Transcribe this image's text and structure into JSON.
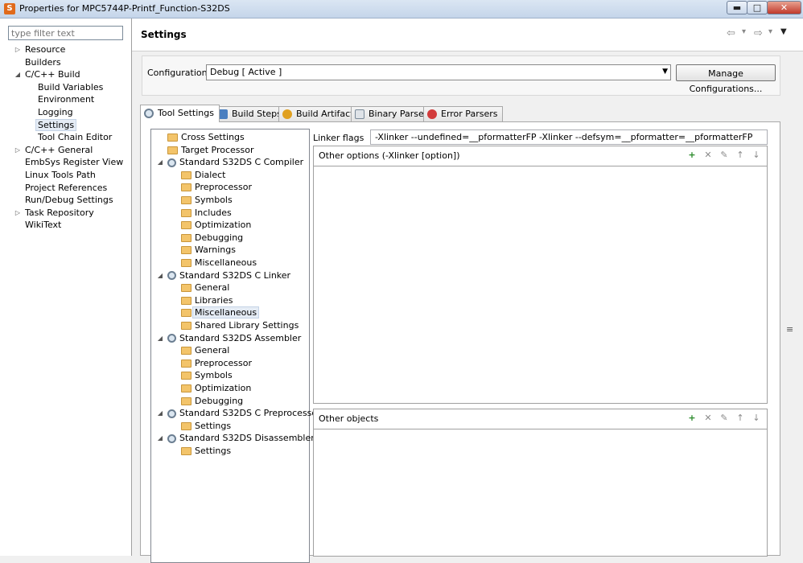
{
  "window": {
    "title": "Properties for MPC5744P-Printf_Function-S32DS",
    "app_icon_glyph": "S",
    "minimize_glyph": "▬",
    "maximize_glyph": "□",
    "close_glyph": "✕"
  },
  "filter": {
    "placeholder": "type filter text"
  },
  "nav": [
    {
      "label": "Resource",
      "twisty": "▷"
    },
    {
      "label": "Builders",
      "twisty": ""
    },
    {
      "label": "C/C++ Build",
      "twisty": "◢"
    },
    {
      "label": "Build Variables",
      "twisty": ""
    },
    {
      "label": "Environment",
      "twisty": ""
    },
    {
      "label": "Logging",
      "twisty": ""
    },
    {
      "label": "Settings",
      "twisty": ""
    },
    {
      "label": "Tool Chain Editor",
      "twisty": ""
    },
    {
      "label": "C/C++ General",
      "twisty": "▷"
    },
    {
      "label": "EmbSys Register View",
      "twisty": ""
    },
    {
      "label": "Linux Tools Path",
      "twisty": ""
    },
    {
      "label": "Project References",
      "twisty": ""
    },
    {
      "label": "Run/Debug Settings",
      "twisty": ""
    },
    {
      "label": "Task Repository",
      "twisty": "▷"
    },
    {
      "label": "WikiText",
      "twisty": ""
    }
  ],
  "page": {
    "title": "Settings",
    "back_glyph": "⇦",
    "forward_glyph": "⇨",
    "dropdown_glyph": "▾",
    "menu_glyph": "▼"
  },
  "config": {
    "label": "Configuration:",
    "value": "Debug  [ Active ]",
    "dropdown_glyph": "▼",
    "manage_label": "Manage Configurations..."
  },
  "tabs": [
    {
      "label": "Tool Settings",
      "icon_color": "#6b7e91"
    },
    {
      "label": "Build Steps",
      "icon_color": "#4a7fc0"
    },
    {
      "label": "Build Artifact",
      "icon_color": "#e0a020"
    },
    {
      "label": "Binary Parsers",
      "icon_color": "#7a8a99"
    },
    {
      "label": "Error Parsers",
      "icon_color": "#d23b3b"
    }
  ],
  "tools": [
    "Cross Settings",
    "Target Processor",
    "Standard S32DS C Compiler",
    "Dialect",
    "Preprocessor",
    "Symbols",
    "Includes",
    "Optimization",
    "Debugging",
    "Warnings",
    "Miscellaneous",
    "Standard S32DS C Linker",
    "General",
    "Libraries",
    "Miscellaneous",
    "Shared Library Settings",
    "Standard S32DS Assembler",
    "General",
    "Preprocessor",
    "Symbols",
    "Optimization",
    "Debugging",
    "Standard S32DS C Preprocessor",
    "Settings",
    "Standard S32DS Disassembler",
    "Settings"
  ],
  "tree_expand_glyph": "◢",
  "linker": {
    "flags_label": "Linker flags",
    "flags_value": "-Xlinker --undefined=__pformatterFP -Xlinker --defsym=__pformatter=__pformatterFP",
    "other_options_label": "Other options (-Xlinker [option])",
    "other_objects_label": "Other objects"
  },
  "list_toolbar": {
    "add_glyph": "+",
    "delete_glyph": "✕",
    "edit_glyph": "✎",
    "up_glyph": "↑",
    "down_glyph": "↓"
  },
  "scroll_grip_glyph": "≡"
}
